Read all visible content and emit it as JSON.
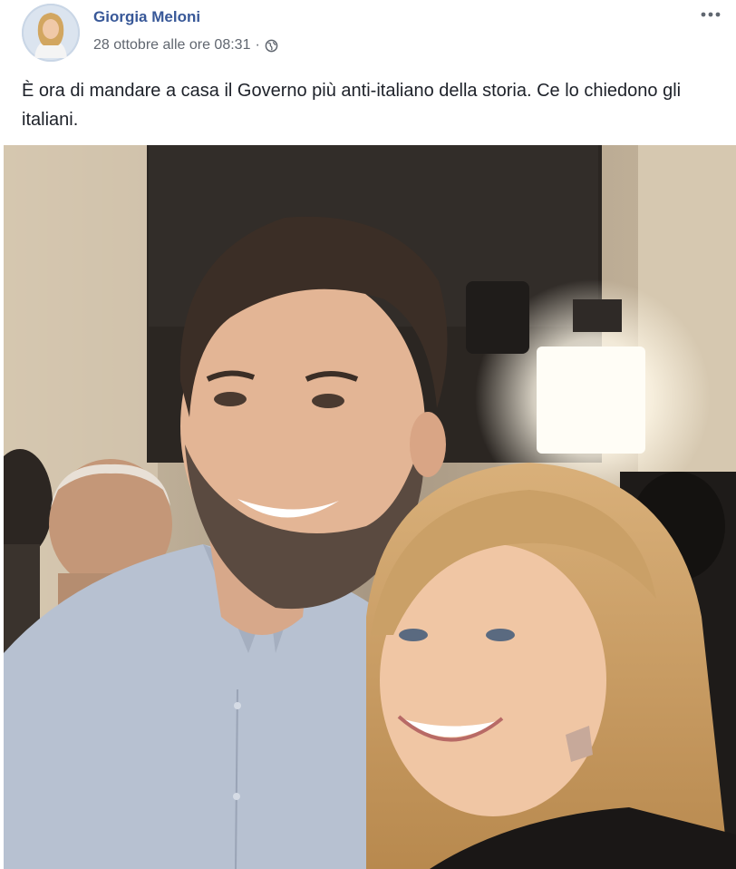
{
  "post": {
    "author": "Giorgia Meloni",
    "timestamp": "28 ottobre alle ore 08:31",
    "separator": "·",
    "privacy_icon": "globe-icon",
    "more_icon": "more-options-icon",
    "text": "È ora di mandare a casa il Governo più anti-italiano della storia. Ce lo chiedono gli italiani."
  },
  "colors": {
    "author_link": "#385898",
    "meta_text": "#616770",
    "body_text": "#1d2129"
  }
}
